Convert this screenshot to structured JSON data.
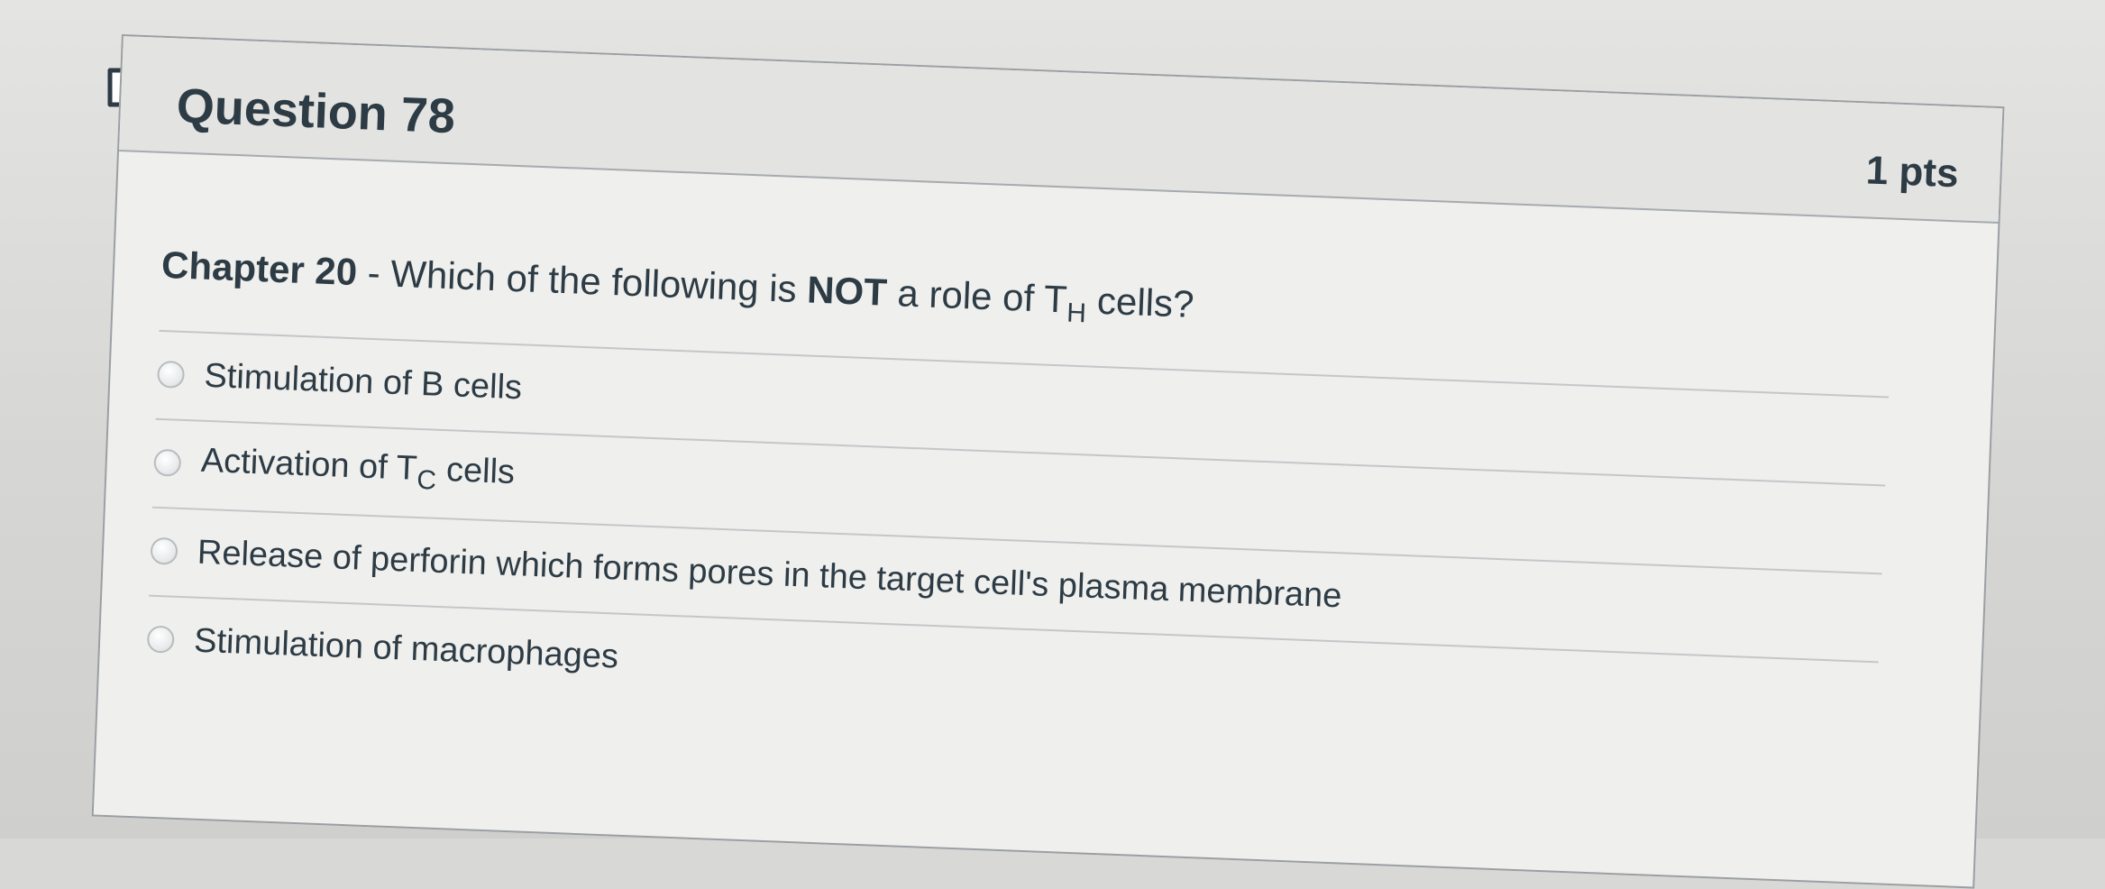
{
  "question": {
    "title": "Question 78",
    "points": "1 pts",
    "chapter": "Chapter 20",
    "stem_prefix": " - Which of the following is ",
    "stem_emphasis": "NOT",
    "stem_middle": " a role of T",
    "stem_subscript": "H",
    "stem_suffix": " cells?"
  },
  "answers": [
    {
      "label": "Stimulation of B cells"
    },
    {
      "label_prefix": "Activation of T",
      "label_subscript": "C",
      "label_suffix": " cells"
    },
    {
      "label": "Release of perforin which forms pores in the target cell's plasma membrane"
    },
    {
      "label": "Stimulation of macrophages"
    }
  ]
}
